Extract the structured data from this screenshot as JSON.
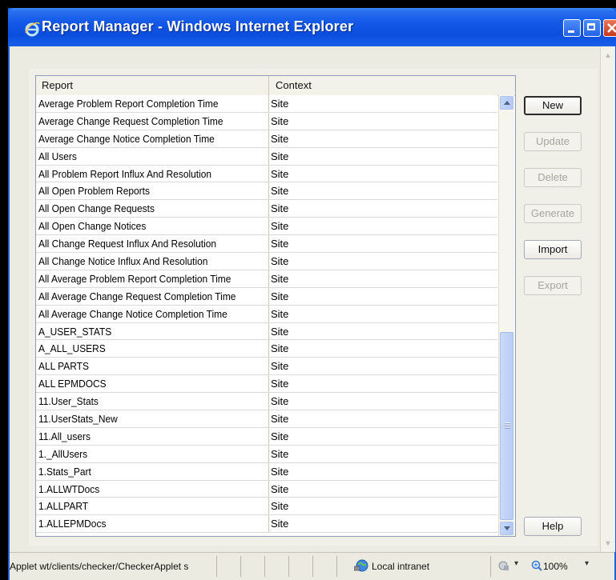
{
  "window": {
    "title": "Report Manager - Windows Internet Explorer"
  },
  "table": {
    "headers": {
      "report": "Report",
      "context": "Context"
    },
    "rows": [
      {
        "report": "Average Problem Report Completion Time",
        "context": "Site"
      },
      {
        "report": "Average Change Request Completion Time",
        "context": "Site"
      },
      {
        "report": "Average Change Notice Completion Time",
        "context": "Site"
      },
      {
        "report": "All Users",
        "context": "Site"
      },
      {
        "report": "All Problem Report Influx And Resolution",
        "context": "Site"
      },
      {
        "report": "All Open Problem Reports",
        "context": "Site"
      },
      {
        "report": "All Open Change Requests",
        "context": "Site"
      },
      {
        "report": "All Open Change Notices",
        "context": "Site"
      },
      {
        "report": "All Change Request Influx And Resolution",
        "context": "Site"
      },
      {
        "report": "All Change Notice Influx And Resolution",
        "context": "Site"
      },
      {
        "report": "All Average Problem Report Completion Time",
        "context": "Site"
      },
      {
        "report": "All Average Change Request Completion Time",
        "context": "Site"
      },
      {
        "report": "All Average Change Notice Completion Time",
        "context": "Site"
      },
      {
        "report": "A_USER_STATS",
        "context": "Site"
      },
      {
        "report": "A_ALL_USERS",
        "context": "Site"
      },
      {
        "report": "ALL PARTS",
        "context": "Site"
      },
      {
        "report": "ALL EPMDOCS",
        "context": "Site"
      },
      {
        "report": "11.User_Stats",
        "context": "Site"
      },
      {
        "report": "11.UserStats_New",
        "context": "Site"
      },
      {
        "report": "11.All_users",
        "context": "Site"
      },
      {
        "report": "1._AllUsers",
        "context": "Site"
      },
      {
        "report": "1.Stats_Part",
        "context": "Site"
      },
      {
        "report": "1.ALLWTDocs",
        "context": "Site"
      },
      {
        "report": "1.ALLPART",
        "context": "Site"
      },
      {
        "report": "1.ALLEPMDocs",
        "context": "Site"
      }
    ]
  },
  "buttons": {
    "new": "New",
    "update": "Update",
    "delete": "Delete",
    "generate": "Generate",
    "import": "Import",
    "export": "Export",
    "help": "Help"
  },
  "statusbar": {
    "message": "Applet wt/clients/checker/CheckerApplet s",
    "zone": "Local intranet",
    "zoom": "100%"
  },
  "icons": {
    "browser": "internet-explorer-icon",
    "minimize": "minimize-icon",
    "maximize": "maximize-icon",
    "close": "close-icon",
    "zone": "local-intranet-globe-icon",
    "security": "protected-mode-icon",
    "zoom": "zoom-magnifier-icon"
  },
  "colors": {
    "titlebar": "#0b4ede",
    "close_button": "#c6381c",
    "scrollbar": "#b8cdf6"
  }
}
